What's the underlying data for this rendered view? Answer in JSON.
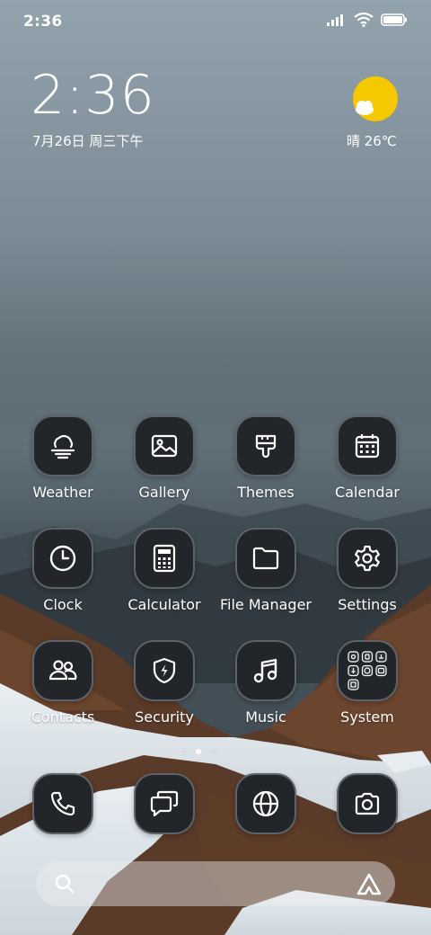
{
  "status_bar": {
    "time": "2:36"
  },
  "clock_widget": {
    "time": "2:36",
    "date": "7月26日 周三下午"
  },
  "weather_widget": {
    "condition_temp": "晴 26℃",
    "sun_color": "#f5c800"
  },
  "apps": [
    {
      "label": "Weather",
      "icon": "weather-icon"
    },
    {
      "label": "Gallery",
      "icon": "gallery-icon"
    },
    {
      "label": "Themes",
      "icon": "themes-icon"
    },
    {
      "label": "Calendar",
      "icon": "calendar-icon"
    },
    {
      "label": "Clock",
      "icon": "clock-icon"
    },
    {
      "label": "Calculator",
      "icon": "calculator-icon"
    },
    {
      "label": "File Manager",
      "icon": "folder-icon"
    },
    {
      "label": "Settings",
      "icon": "gear-icon"
    },
    {
      "label": "Contacts",
      "icon": "contacts-icon"
    },
    {
      "label": "Security",
      "icon": "shield-icon"
    },
    {
      "label": "Music",
      "icon": "music-icon"
    },
    {
      "label": "System",
      "icon": "system-folder-icon"
    }
  ],
  "dock": [
    {
      "icon": "phone-icon"
    },
    {
      "icon": "messages-icon"
    },
    {
      "icon": "browser-icon"
    },
    {
      "icon": "camera-icon"
    }
  ],
  "page_indicator": {
    "pages": 2,
    "current": 1
  },
  "search_bar": {
    "icon": "search-icon",
    "assistant_icon": "assistant-icon"
  }
}
